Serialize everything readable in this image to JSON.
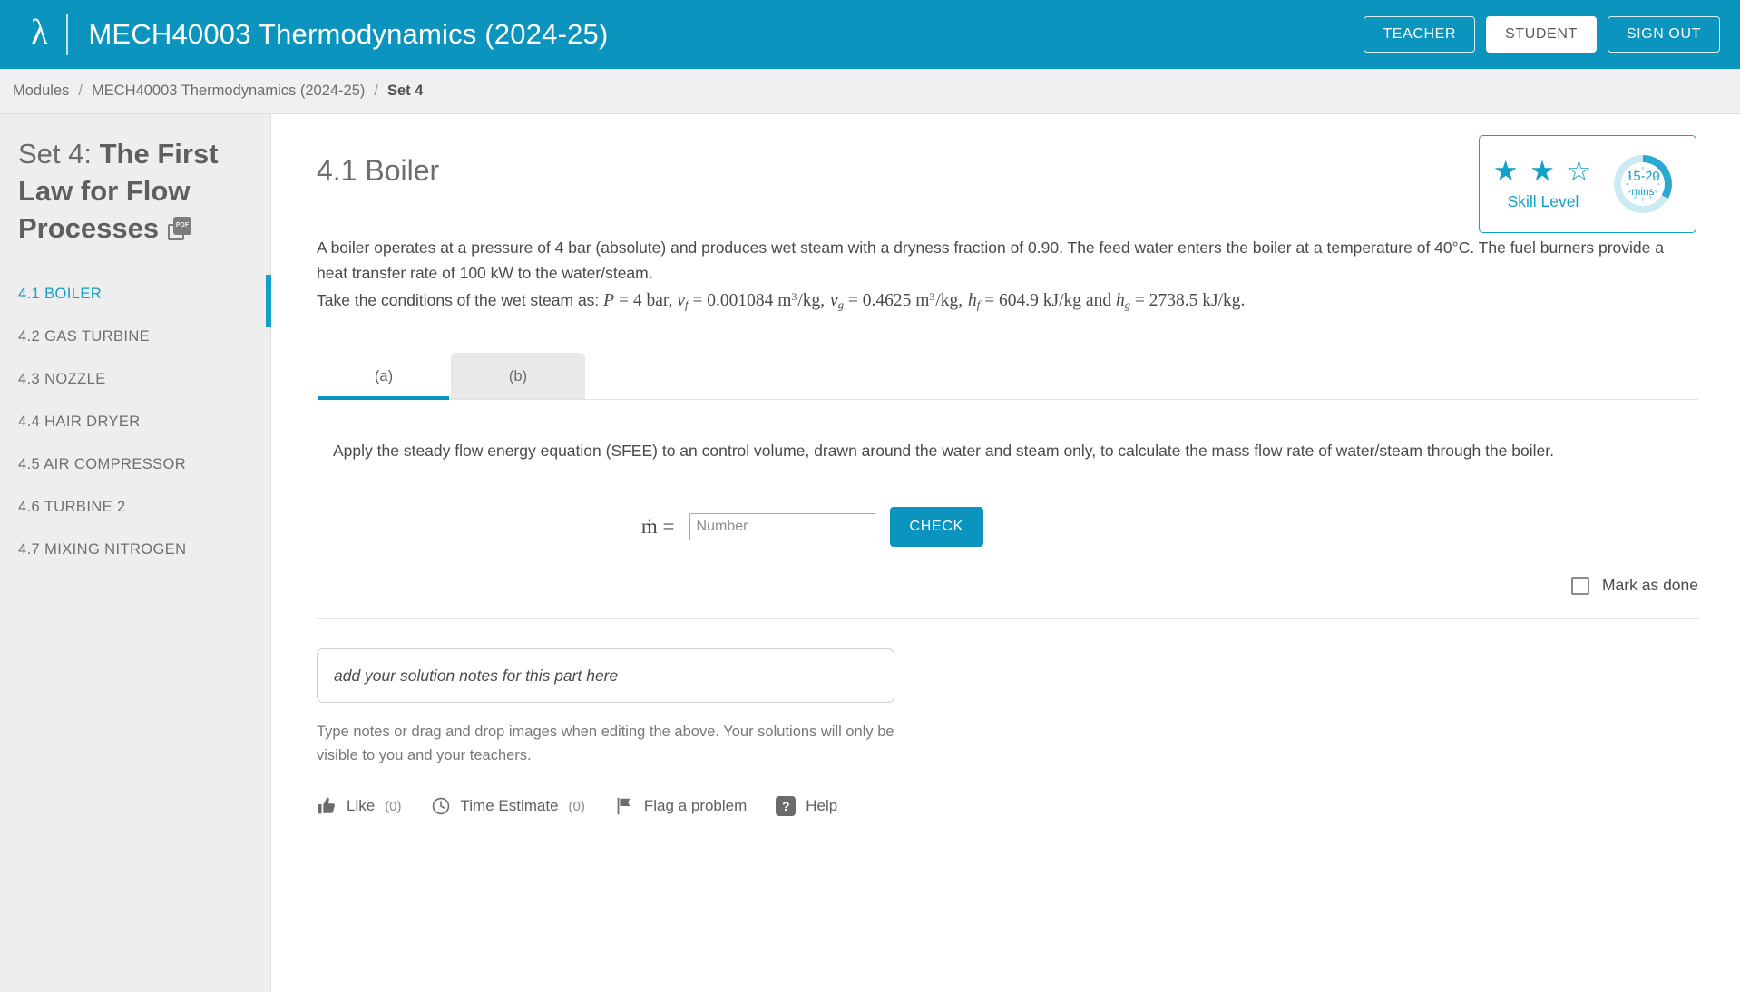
{
  "header": {
    "logo": "lambda-logo",
    "course_title": "MECH40003 Thermodynamics (2024-25)",
    "buttons": {
      "teacher": "TEACHER",
      "student": "STUDENT",
      "sign_out": "SIGN OUT"
    }
  },
  "breadcrumb": {
    "modules": "Modules",
    "course": "MECH40003 Thermodynamics (2024-25)",
    "current": "Set 4",
    "separator": "/"
  },
  "sidebar": {
    "set_prefix": "Set 4:",
    "set_name": "The First Law for Flow Processes",
    "pdf_icon_label": "PDF",
    "items": [
      {
        "label": "4.1 BOILER",
        "active": true
      },
      {
        "label": "4.2 GAS TURBINE",
        "active": false
      },
      {
        "label": "4.3 NOZZLE",
        "active": false
      },
      {
        "label": "4.4 HAIR DRYER",
        "active": false
      },
      {
        "label": "4.5 AIR COMPRESSOR",
        "active": false
      },
      {
        "label": "4.6 TURBINE 2",
        "active": false
      },
      {
        "label": "4.7 MIXING NITROGEN",
        "active": false
      }
    ]
  },
  "badge": {
    "stars_filled": 2,
    "stars_total": 3,
    "stars_glyphs": "★ ★ ☆",
    "skill_label": "Skill Level",
    "time_range": "15-20",
    "time_unit": "mins",
    "accent_color": "#12a0c8"
  },
  "question": {
    "title": "4.1 Boiler",
    "statement_line1": "A boiler operates at a pressure of 4 bar (absolute) and produces wet steam with a dryness fraction of 0.90. The feed water enters the boiler at a temperature of 40°C. The fuel burners provide a heat transfer rate of 100 kW to the water/steam.",
    "conditions_lead": "Take the conditions of the wet steam as:",
    "conditions": {
      "P_var": "P",
      "P_eq": "= 4 bar,",
      "vf_var": "v",
      "vf_sub": "f",
      "vf_val": "= 0.001084 m",
      "vf_exp": "3",
      "vf_unit": "/kg,",
      "vg_var": "v",
      "vg_sub": "g",
      "vg_val": "= 0.4625 m",
      "vg_exp": "3",
      "vg_unit": "/kg,",
      "hf_var": "h",
      "hf_sub": "f",
      "hf_val": "= 604.9 kJ/kg and",
      "hg_var": "h",
      "hg_sub": "g",
      "hg_val": "= 2738.5 kJ/kg."
    }
  },
  "tabs": [
    {
      "label": "(a)",
      "active": true
    },
    {
      "label": "(b)",
      "active": false
    }
  ],
  "part": {
    "text": "Apply the steady flow energy equation (SFEE) to an control volume, drawn around the water and steam only, to calculate the mass flow rate of water/steam through the boiler.",
    "answer_var": "ṁ =",
    "answer_value": "",
    "answer_placeholder": "Number",
    "check_label": "CHECK"
  },
  "mark_done": {
    "label": "Mark as done",
    "checked": false
  },
  "notes": {
    "placeholder": "add your solution notes for this part here",
    "value": "",
    "help": "Type notes or drag and drop images when editing the above. Your solutions will only be visible to you and your teachers."
  },
  "actions": {
    "like": {
      "label": "Like",
      "count": "(0)",
      "icon": "thumbs-up-icon"
    },
    "time_estimate": {
      "label": "Time Estimate",
      "count": "(0)",
      "icon": "clock-icon"
    },
    "flag": {
      "label": "Flag a problem",
      "icon": "flag-icon"
    },
    "help": {
      "label": "Help",
      "icon": "question-mark-icon"
    }
  },
  "colors": {
    "brand": "#0b94bd",
    "accent": "#12a0c8",
    "sidebar_bg": "#eeeeee"
  }
}
